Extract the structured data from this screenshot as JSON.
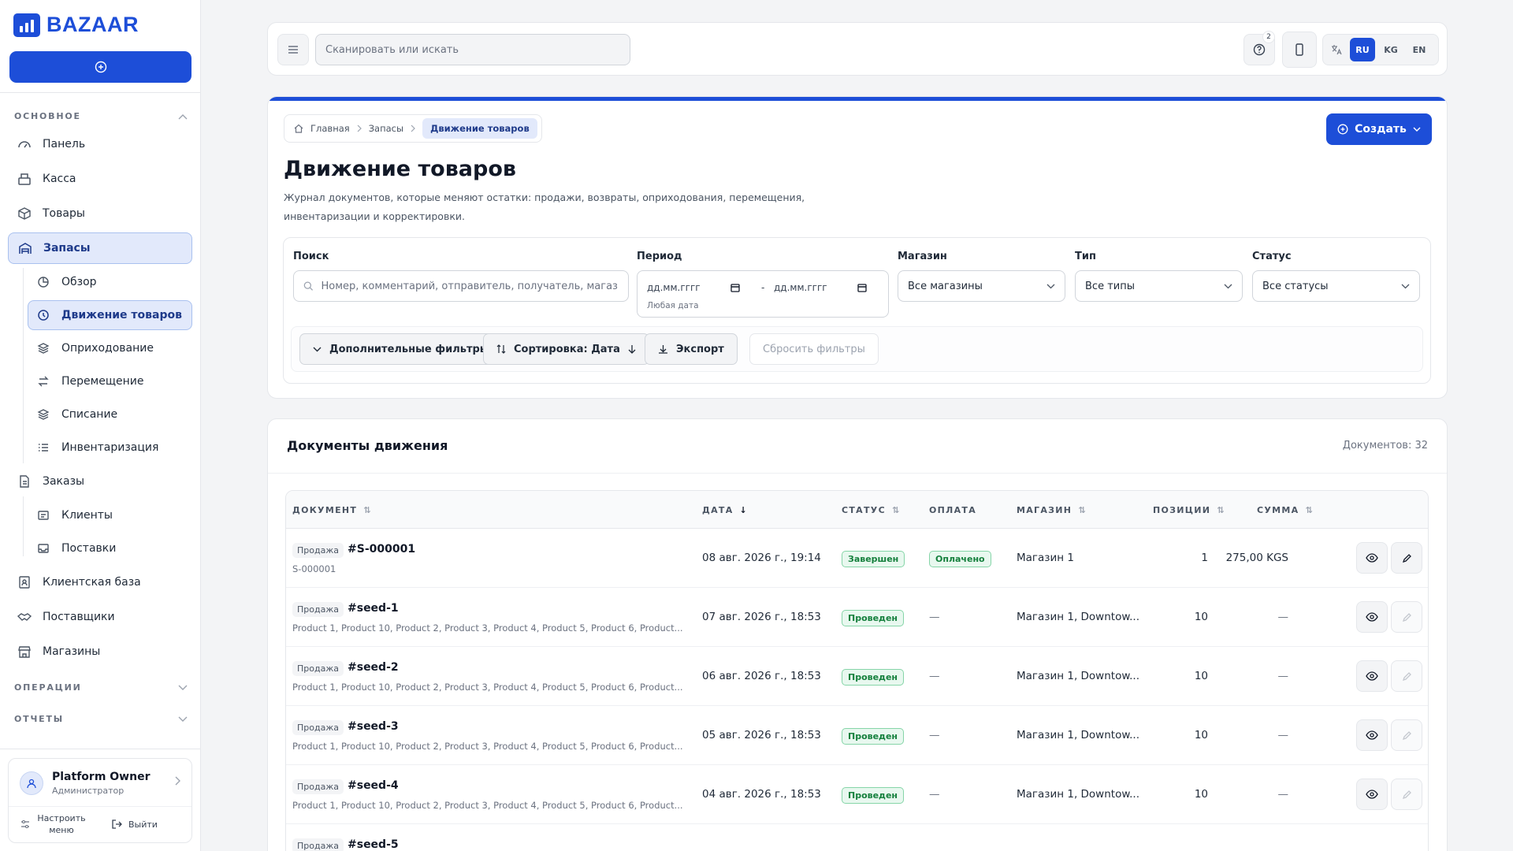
{
  "brand": {
    "name": "BAZAAR",
    "color": "#1d4ed8"
  },
  "sidebar": {
    "sections": [
      {
        "label": "ОСНОВНОЕ",
        "expanded": true
      },
      {
        "label": "ОПЕРАЦИИ",
        "expanded": false
      },
      {
        "label": "ОТЧЕТЫ",
        "expanded": false
      }
    ],
    "items": [
      {
        "label": "Панель",
        "icon": "gauge-icon"
      },
      {
        "label": "Касса",
        "icon": "cash-register-icon"
      },
      {
        "label": "Товары",
        "icon": "box-icon"
      },
      {
        "label": "Запасы",
        "icon": "warehouse-icon",
        "active": true
      },
      {
        "label": "Обзор",
        "icon": "pie-chart-icon"
      },
      {
        "label": "Движение товаров",
        "icon": "history-icon",
        "active": true
      },
      {
        "label": "Оприходование",
        "icon": "layers-plus-icon"
      },
      {
        "label": "Перемещение",
        "icon": "arrows-swap-icon"
      },
      {
        "label": "Списание",
        "icon": "layers-minus-icon"
      },
      {
        "label": "Инвентаризация",
        "icon": "checklist-icon"
      },
      {
        "label": "Заказы",
        "icon": "document-icon"
      },
      {
        "label": "Клиенты",
        "icon": "id-card-icon"
      },
      {
        "label": "Поставки",
        "icon": "inbox-icon"
      },
      {
        "label": "Клиентская база",
        "icon": "contacts-icon"
      },
      {
        "label": "Поставщики",
        "icon": "handshake-icon"
      },
      {
        "label": "Магазины",
        "icon": "store-icon"
      }
    ],
    "user": {
      "name": "Platform Owner",
      "role": "Администратор"
    },
    "configure_menu": "Настроить меню",
    "logout": "Выйти"
  },
  "topbar": {
    "search_placeholder": "Сканировать или искать",
    "help_badge": "2",
    "languages": [
      "RU",
      "KG",
      "EN"
    ],
    "active_language": "RU"
  },
  "header": {
    "breadcrumbs": [
      "Главная",
      "Запасы",
      "Движение товаров"
    ],
    "title": "Движение товаров",
    "description": "Журнал документов, которые меняют остатки: продажи, возвраты, оприходования, перемещения, инвентаризации и корректировки.",
    "create_label": "Создать"
  },
  "filters": {
    "search_label": "Поиск",
    "search_placeholder": "Номер, комментарий, отправитель, получатель, магазин или",
    "period_label": "Период",
    "date_from": "дд.мм.гггг",
    "date_to": "дд.мм.гггг",
    "date_separator": "-",
    "period_hint": "Любая дата",
    "store_label": "Магазин",
    "store_value": "Все магазины",
    "type_label": "Тип",
    "type_value": "Все типы",
    "status_label": "Статус",
    "status_value": "Все статусы",
    "more_filters": "Дополнительные фильтры",
    "sort": "Сортировка: Дата",
    "export": "Экспорт",
    "reset": "Сбросить фильтры"
  },
  "table": {
    "title": "Документы движения",
    "count": "Документов: 32",
    "columns": [
      "ДОКУМЕНТ",
      "ДАТА",
      "СТАТУС",
      "ОПЛАТА",
      "МАГАЗИН",
      "ПОЗИЦИИ",
      "СУММА"
    ],
    "rows": [
      {
        "type": "Продажа",
        "number": "#S-000001",
        "sub": "S-000001",
        "date": "08 авг. 2026 г., 19:14",
        "status": "Завершен",
        "payment": "Оплачено",
        "store": "Магазин 1",
        "positions": "1",
        "sum": "275,00 KGS"
      },
      {
        "type": "Продажа",
        "number": "#seed-1",
        "sub": "Product 1, Product 10, Product 2, Product 3, Product 4, Product 5, Product 6, Product...",
        "date": "07 авг. 2026 г., 18:53",
        "status": "Проведен",
        "payment": "—",
        "store": "Магазин 1, Downtow...",
        "positions": "10",
        "sum": "—"
      },
      {
        "type": "Продажа",
        "number": "#seed-2",
        "sub": "Product 1, Product 10, Product 2, Product 3, Product 4, Product 5, Product 6, Product...",
        "date": "06 авг. 2026 г., 18:53",
        "status": "Проведен",
        "payment": "—",
        "store": "Магазин 1, Downtow...",
        "positions": "10",
        "sum": "—"
      },
      {
        "type": "Продажа",
        "number": "#seed-3",
        "sub": "Product 1, Product 10, Product 2, Product 3, Product 4, Product 5, Product 6, Product...",
        "date": "05 авг. 2026 г., 18:53",
        "status": "Проведен",
        "payment": "—",
        "store": "Магазин 1, Downtow...",
        "positions": "10",
        "sum": "—"
      },
      {
        "type": "Продажа",
        "number": "#seed-4",
        "sub": "Product 1, Product 10, Product 2, Product 3, Product 4, Product 5, Product 6, Product...",
        "date": "04 авг. 2026 г., 18:53",
        "status": "Проведен",
        "payment": "—",
        "store": "Магазин 1, Downtow...",
        "positions": "10",
        "sum": "—"
      },
      {
        "type": "Продажа",
        "number": "#seed-5",
        "sub": "",
        "date": "",
        "status": "",
        "payment": "",
        "store": "",
        "positions": "",
        "sum": ""
      }
    ]
  }
}
